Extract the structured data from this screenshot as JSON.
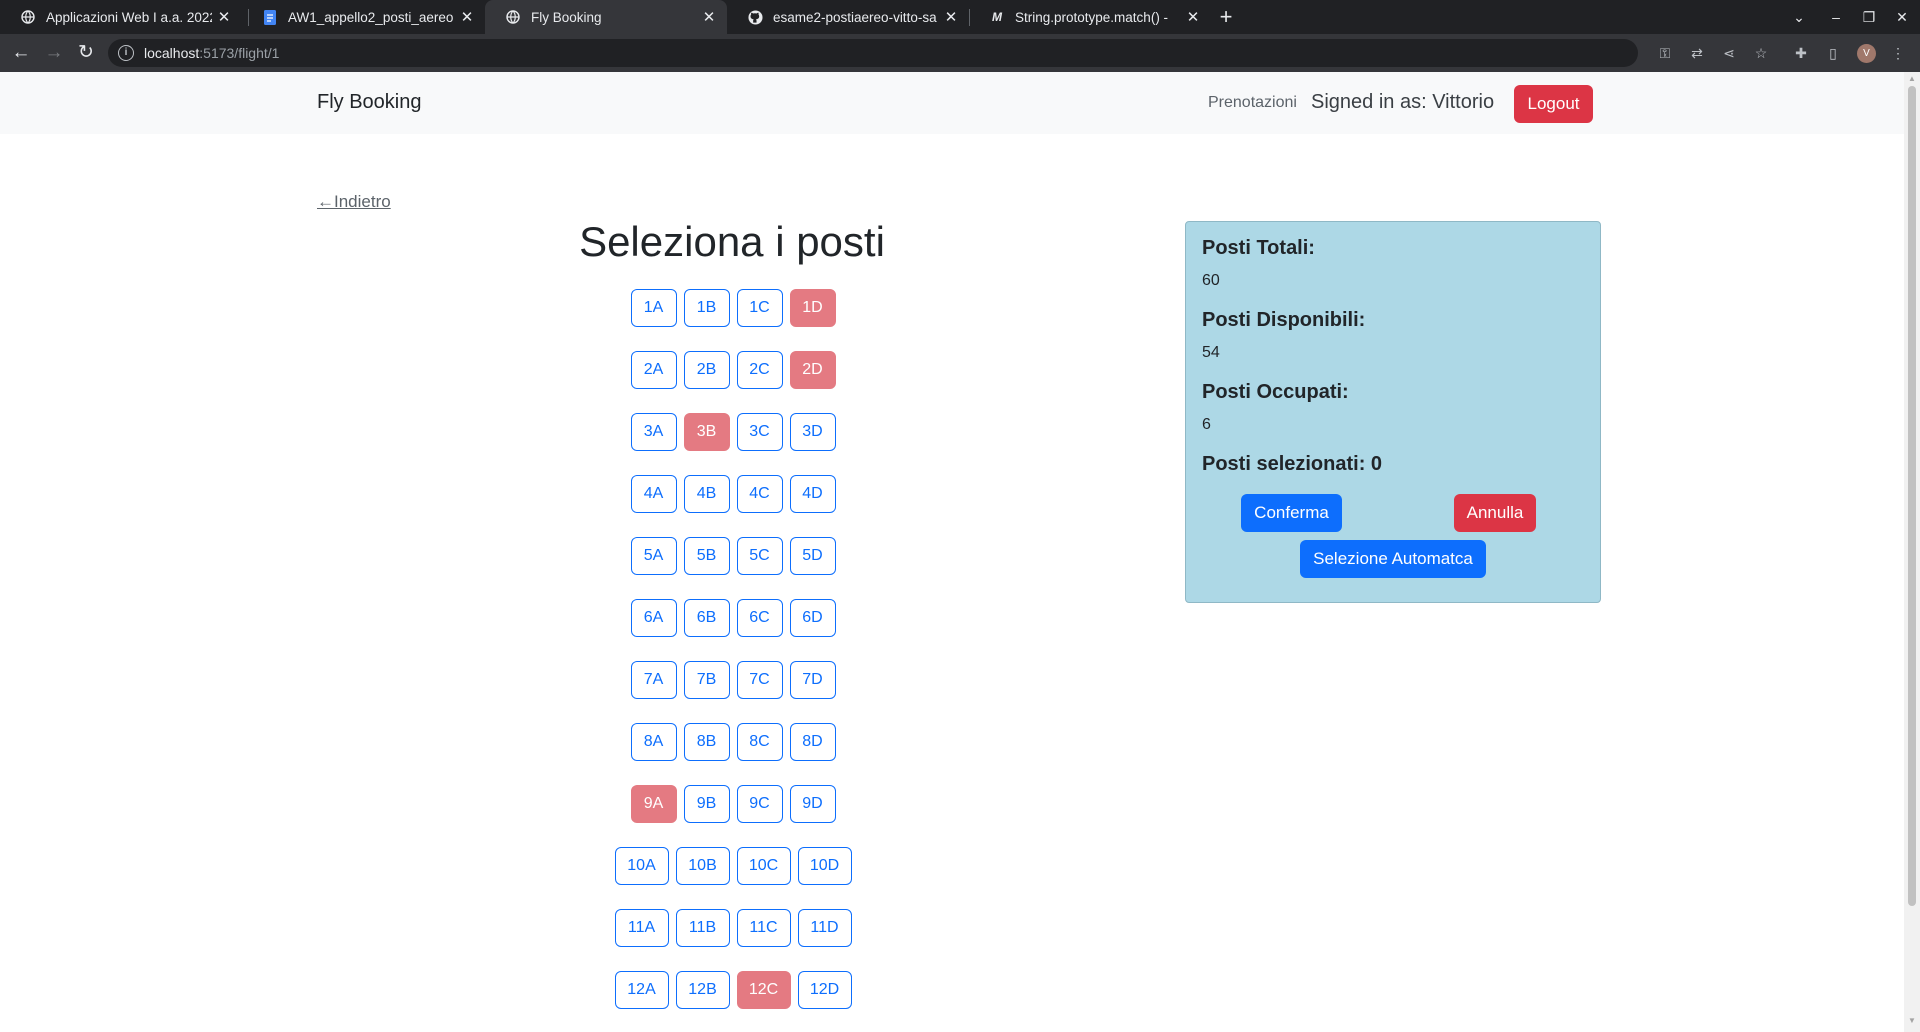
{
  "browser": {
    "tabs": [
      {
        "title": "Applicazioni Web I a.a. 2022",
        "icon": "globe-icon"
      },
      {
        "title": "AW1_appello2_posti_aereo -",
        "icon": "docs-icon"
      },
      {
        "title": "Fly Booking",
        "icon": "globe-icon"
      },
      {
        "title": "esame2-postiaereo-vitto-sa",
        "icon": "github-icon"
      },
      {
        "title": "String.prototype.match() -",
        "icon": "mdn-icon"
      }
    ],
    "url_host": "localhost",
    "url_path": ":5173/flight/1",
    "profile_initial": "V"
  },
  "navbar": {
    "brand": "Fly Booking",
    "reservations_link": "Prenotazioni",
    "signed_in": "Signed in as: Vittorio",
    "logout": "Logout"
  },
  "back_link": "Indietro",
  "back_arrow": "←",
  "heading": "Seleziona i posti",
  "seats": [
    [
      "1A",
      "1B",
      "1C",
      "1D"
    ],
    [
      "2A",
      "2B",
      "2C",
      "2D"
    ],
    [
      "3A",
      "3B",
      "3C",
      "3D"
    ],
    [
      "4A",
      "4B",
      "4C",
      "4D"
    ],
    [
      "5A",
      "5B",
      "5C",
      "5D"
    ],
    [
      "6A",
      "6B",
      "6C",
      "6D"
    ],
    [
      "7A",
      "7B",
      "7C",
      "7D"
    ],
    [
      "8A",
      "8B",
      "8C",
      "8D"
    ],
    [
      "9A",
      "9B",
      "9C",
      "9D"
    ],
    [
      "10A",
      "10B",
      "10C",
      "10D"
    ],
    [
      "11A",
      "11B",
      "11C",
      "11D"
    ],
    [
      "12A",
      "12B",
      "12C",
      "12D"
    ]
  ],
  "occupied_seats": [
    "1D",
    "2D",
    "3B",
    "9A",
    "12C"
  ],
  "summary": {
    "total_label": "Posti Totali:",
    "total_value": "60",
    "available_label": "Posti Disponibili:",
    "available_value": "54",
    "occupied_label": "Posti Occupati:",
    "occupied_value": "6",
    "selected_label": "Posti selezionati: 0",
    "confirm": "Conferma",
    "cancel": "Annulla",
    "auto_select": "Selezione Automatca"
  },
  "colors": {
    "primary": "#0d6efd",
    "danger": "#dc3545",
    "occupied": "#e47a82",
    "panel": "#add8e6"
  }
}
